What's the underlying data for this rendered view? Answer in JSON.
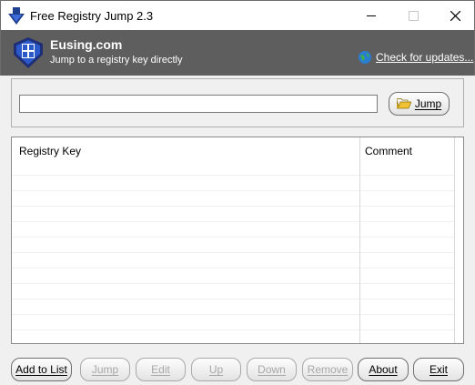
{
  "window": {
    "title": "Free Registry Jump 2.3",
    "minimize_icon": "minimize-icon",
    "maximize_icon": "maximize-icon",
    "close_icon": "close-icon"
  },
  "header": {
    "brand": "Eusing.com",
    "tagline": "Jump to a registry key directly",
    "update_link": "Check for updates...",
    "background_color": "#5e5e5e"
  },
  "jump_panel": {
    "input_value": "",
    "jump_label": "Jump"
  },
  "list": {
    "columns": [
      "Registry Key",
      "Comment"
    ]
  },
  "buttons": {
    "add_to_list": "Add to List",
    "jump": "Jump",
    "edit": "Edit",
    "up": "Up",
    "down": "Down",
    "remove": "Remove",
    "about": "About",
    "exit": "Exit"
  }
}
